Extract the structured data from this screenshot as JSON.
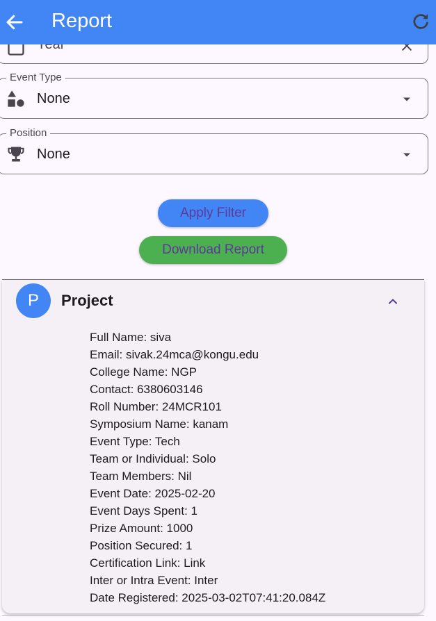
{
  "app_bar": {
    "title": "Report",
    "back_icon": "arrow-left-icon",
    "refresh_icon": "refresh-icon"
  },
  "filters": {
    "year": {
      "value": "Year",
      "lead_icon": "calendar-icon",
      "trail_icon": "close-icon"
    },
    "event_type": {
      "label": "Event Type",
      "value": "None",
      "lead_icon": "category-shapes-icon",
      "trail_icon": "dropdown-arrow-icon"
    },
    "position": {
      "label": "Position",
      "value": "None",
      "lead_icon": "trophy-icon",
      "trail_icon": "dropdown-arrow-icon"
    }
  },
  "buttons": {
    "apply": "Apply Filter",
    "download": "Download Report"
  },
  "card": {
    "avatar_letter": "P",
    "title": "Project",
    "details": [
      "Full Name: siva",
      "Email: sivak.24mca@kongu.edu",
      "College Name: NGP",
      "Contact: 6380603146",
      "Roll Number: 24MCR101",
      "Symposium Name: kanam",
      "Event Type: Tech",
      "Team or Individual: Solo",
      "Team Members: Nil",
      "Event Date: 2025-02-20",
      "Event Days Spent: 1",
      "Prize Amount: 1000",
      "Position Secured: 1",
      "Certification Link: Link",
      "Inter or Intra Event: Inter",
      "Date Registered: 2025-03-02T07:41:20.084Z"
    ]
  },
  "colors": {
    "app_bar": "#4285f4",
    "apply_button": "#4285f4",
    "download_button": "#4caf50",
    "button_text": "#5b3b9a",
    "background": "#fdf7ff",
    "card": "#f4f0f6"
  }
}
